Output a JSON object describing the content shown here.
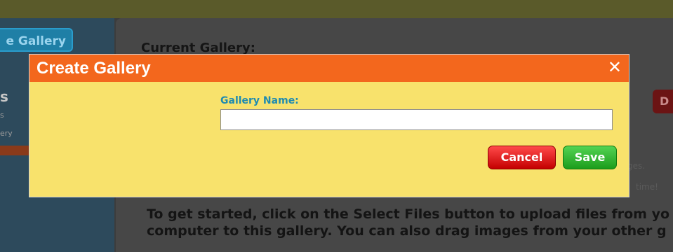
{
  "background": {
    "sidebar": {
      "button_label": "e Gallery",
      "heading": "s",
      "items": [
        "s",
        "ery"
      ]
    },
    "main": {
      "current_label": "Current Gallery:",
      "red_button_label": "D",
      "hint1": "ges.",
      "hint2": "time!",
      "instructions_line1": "To get started, click on the Select Files button to upload files from yo",
      "instructions_line2": "computer to this gallery. You can also drag images from your other g"
    }
  },
  "dialog": {
    "title": "Create Gallery",
    "close_symbol": "✕",
    "field_label": "Gallery Name:",
    "field_value": "",
    "field_placeholder": "",
    "cancel_label": "Cancel",
    "save_label": "Save"
  },
  "colors": {
    "titlebar": "#f3671d",
    "dialog_body": "#f8e26c",
    "label": "#1f8bb0",
    "cancel": "#d90f0f",
    "save": "#2bb52b"
  }
}
